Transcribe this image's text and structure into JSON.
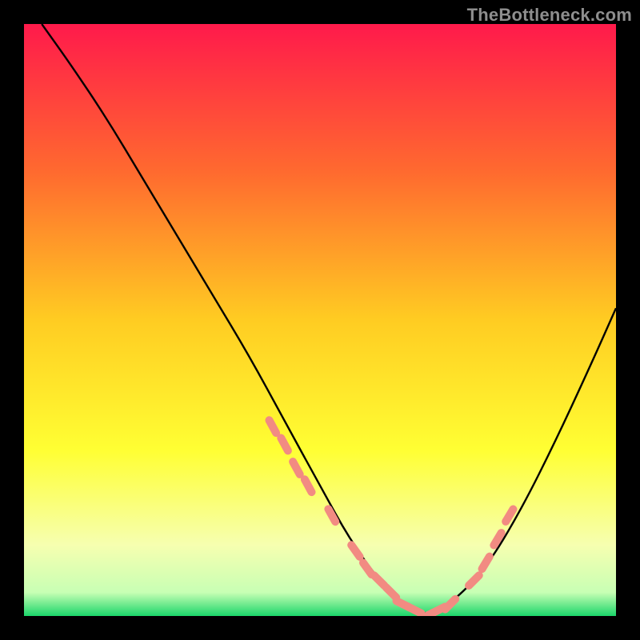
{
  "watermark": "TheBottleneck.com",
  "chart_data": {
    "type": "line",
    "title": "",
    "xlabel": "",
    "ylabel": "",
    "xlim": [
      0,
      100
    ],
    "ylim": [
      0,
      100
    ],
    "grid": false,
    "legend": false,
    "gradient_stops": [
      {
        "offset": 0.0,
        "color": "#ff1a4b"
      },
      {
        "offset": 0.25,
        "color": "#ff6a2f"
      },
      {
        "offset": 0.5,
        "color": "#ffcc22"
      },
      {
        "offset": 0.72,
        "color": "#ffff33"
      },
      {
        "offset": 0.88,
        "color": "#f6ffb0"
      },
      {
        "offset": 0.96,
        "color": "#c8ffb4"
      },
      {
        "offset": 1.0,
        "color": "#1bd66a"
      }
    ],
    "series": [
      {
        "name": "bottleneck-curve",
        "color": "#000000",
        "x": [
          3,
          8,
          14,
          20,
          26,
          32,
          38,
          44,
          50,
          55,
          60,
          64,
          68,
          72,
          78,
          84,
          90,
          96,
          100
        ],
        "y": [
          100,
          93,
          84,
          74,
          64,
          54,
          44,
          33,
          22,
          13,
          6,
          2,
          0,
          2,
          8,
          18,
          30,
          43,
          52
        ]
      },
      {
        "name": "highlight-dots",
        "color": "#f28b82",
        "type": "scatter",
        "x": [
          42,
          44,
          46,
          48,
          52,
          56,
          58,
          60,
          62,
          64,
          66,
          68,
          70,
          72,
          76,
          78,
          80,
          82
        ],
        "y": [
          32,
          29,
          25,
          22,
          17,
          11,
          8,
          6,
          4,
          2,
          1,
          0,
          1,
          2,
          6,
          9,
          13,
          17
        ]
      }
    ]
  }
}
